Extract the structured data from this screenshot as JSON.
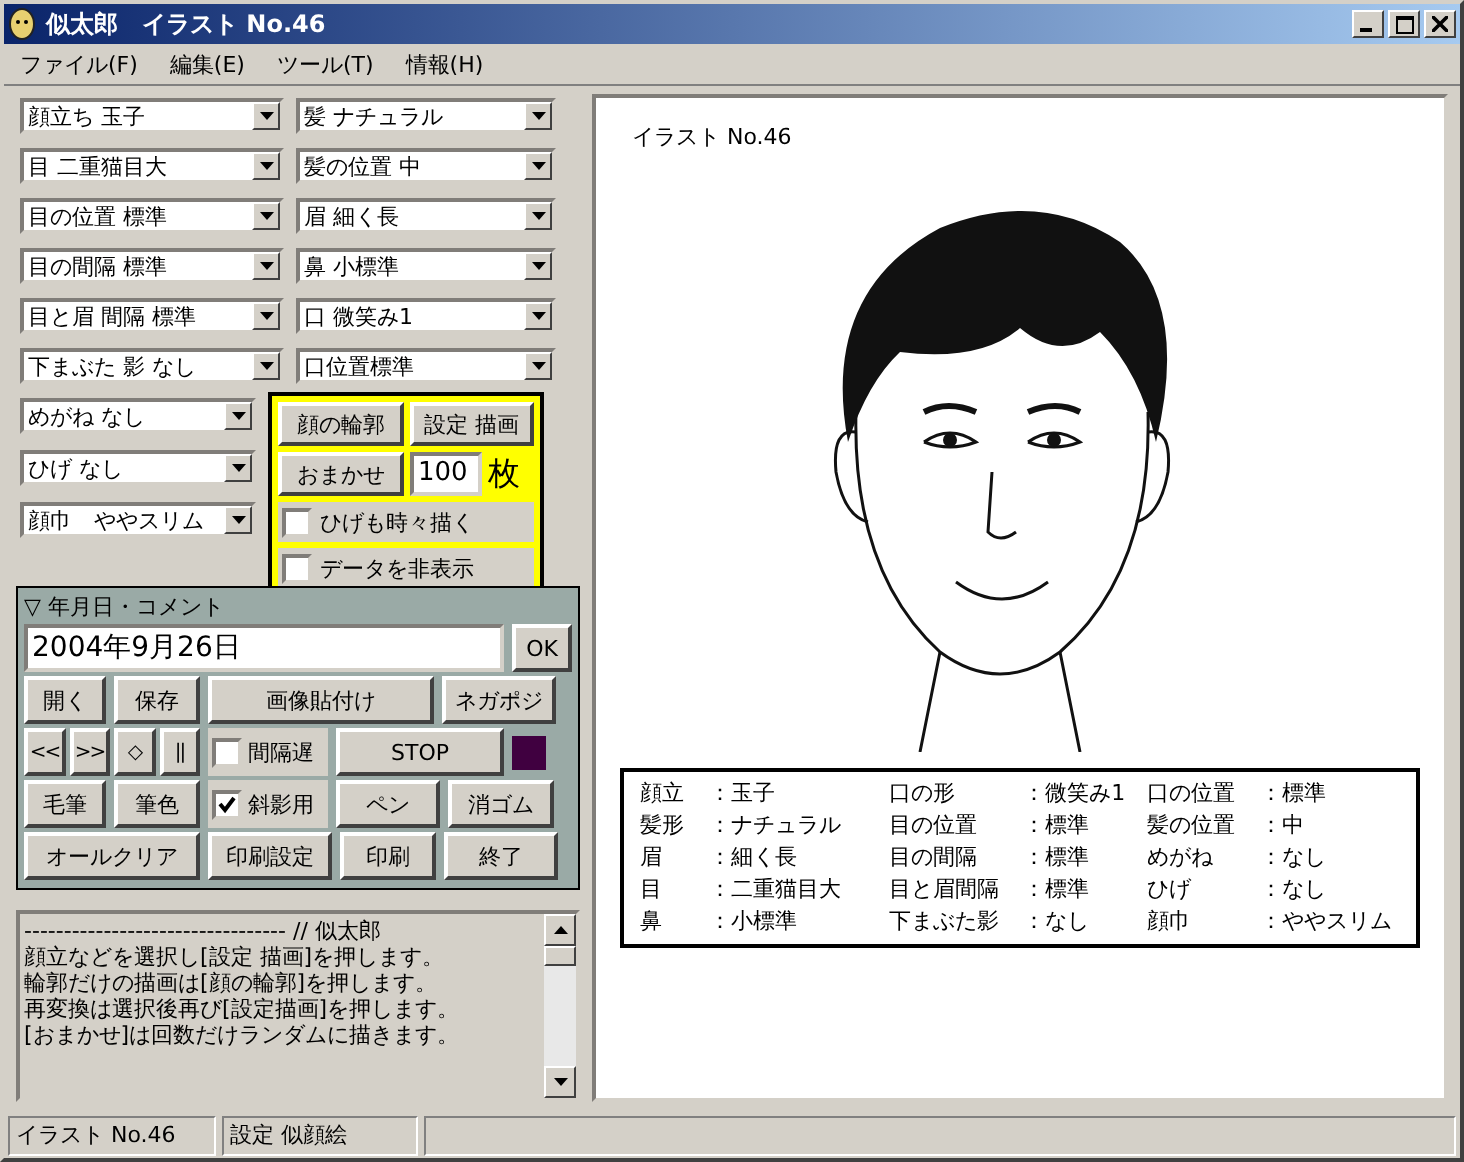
{
  "window": {
    "title": "似太郎　イラスト No.46"
  },
  "menu": [
    "ファイル(F)",
    "編集(E)",
    "ツール(T)",
    "情報(H)"
  ],
  "selects": [
    {
      "value": "顔立ち 玉子"
    },
    {
      "value": "髪 ナチュラル"
    },
    {
      "value": "目 二重猫目大"
    },
    {
      "value": "髪の位置 中"
    },
    {
      "value": "目の位置 標準"
    },
    {
      "value": "眉 細く長"
    },
    {
      "value": "目の間隔 標準"
    },
    {
      "value": "鼻 小標準"
    },
    {
      "value": "目と眉 間隔 標準"
    },
    {
      "value": "口 微笑み1"
    },
    {
      "value": "下まぶた 影 なし"
    },
    {
      "value": "口位置標準"
    }
  ],
  "selects_lower": [
    {
      "value": "めがね なし"
    },
    {
      "value": "ひげ なし"
    },
    {
      "value": "顔巾　ややスリム"
    }
  ],
  "draw_box": {
    "buttons": [
      "顔の輪郭",
      "設定 描画",
      "おまかせ"
    ],
    "count": "100",
    "unit": "枚",
    "checks": [
      {
        "label": "ひげも時々描く",
        "checked": false
      },
      {
        "label": "データを非表示",
        "checked": false
      }
    ]
  },
  "date_panel": {
    "header": "▽ 年月日・コメント",
    "date": "2004年9月26日",
    "ok": "OK",
    "rows": [
      [
        {
          "kind": "button",
          "label": "開く"
        },
        {
          "kind": "button",
          "label": "保存"
        },
        {
          "kind": "button",
          "label": "画像貼付け"
        },
        {
          "kind": "button",
          "label": "ネガポジ"
        }
      ],
      [
        {
          "kind": "group",
          "buttons": [
            "<<",
            ">>",
            "◇",
            "||"
          ]
        },
        {
          "kind": "checkbox",
          "label": "間隔遅",
          "checked": false
        },
        {
          "kind": "button",
          "label": "STOP"
        },
        {
          "kind": "swatch",
          "color": "#400040"
        }
      ],
      [
        {
          "kind": "button",
          "label": "毛筆"
        },
        {
          "kind": "button",
          "label": "筆色"
        },
        {
          "kind": "checkbox",
          "label": "斜影用",
          "checked": true
        },
        {
          "kind": "button",
          "label": "ペン"
        },
        {
          "kind": "button",
          "label": "消ゴム"
        }
      ],
      [
        {
          "kind": "button",
          "label": "オールクリア"
        },
        {
          "kind": "button",
          "label": "印刷設定"
        },
        {
          "kind": "button",
          "label": "印刷"
        },
        {
          "kind": "button",
          "label": "終了"
        }
      ]
    ]
  },
  "memo": [
    "--------------------------------- // 似太郎",
    "顔立などを選択し[設定 描画]を押します。",
    "輪郭だけの描画は[顔の輪郭]を押します。",
    "再変換は選択後再び[設定描画]を押します。",
    "[おまかせ]は回数だけランダムに描きます。"
  ],
  "canvas": {
    "title": "イラスト No.46",
    "summary": [
      [
        {
          "label": "顔立",
          "value": "：玉子"
        },
        {
          "label": "口の形",
          "value": "：微笑み1"
        },
        {
          "label": "口の位置",
          "value": "：標準"
        }
      ],
      [
        {
          "label": "髪形",
          "value": "：ナチュラル"
        },
        {
          "label": "目の位置",
          "value": "：標準"
        },
        {
          "label": "髪の位置",
          "value": "：中"
        }
      ],
      [
        {
          "label": "眉",
          "value": "：細く長"
        },
        {
          "label": "目の間隔",
          "value": "：標準"
        },
        {
          "label": "めがね",
          "value": "：なし"
        }
      ],
      [
        {
          "label": "目",
          "value": "：二重猫目大"
        },
        {
          "label": "目と眉間隔",
          "value": "：標準"
        },
        {
          "label": "ひげ",
          "value": "：なし"
        }
      ],
      [
        {
          "label": "鼻",
          "value": "：小標準"
        },
        {
          "label": "下まぶた影",
          "value": "：なし"
        },
        {
          "label": "顔巾",
          "value": "：ややスリム"
        }
      ]
    ]
  },
  "status_bar": [
    "イラスト No.46",
    "設定 似顔絵"
  ]
}
